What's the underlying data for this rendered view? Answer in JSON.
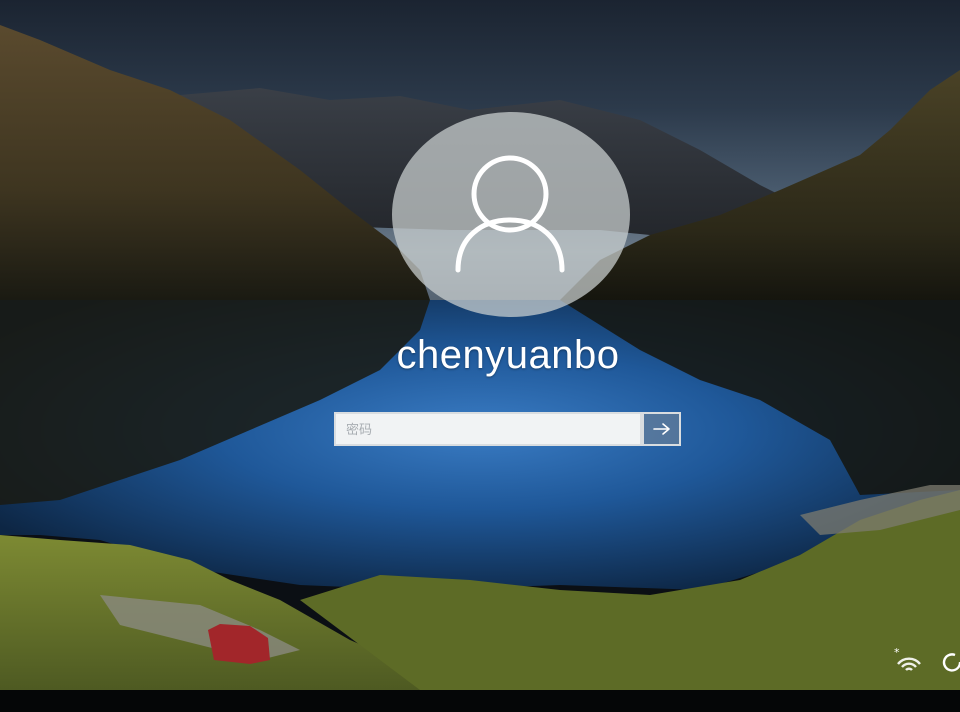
{
  "login": {
    "username": "chenyuanbo",
    "password_placeholder": "密码"
  },
  "icons": {
    "avatar": "user-icon",
    "submit": "arrow-right-icon",
    "network": "wifi-icon",
    "power": "power-icon"
  },
  "colors": {
    "avatar_fill": "#cdd2d2",
    "field_bg": "#f1f3f4",
    "text": "#ffffff"
  }
}
